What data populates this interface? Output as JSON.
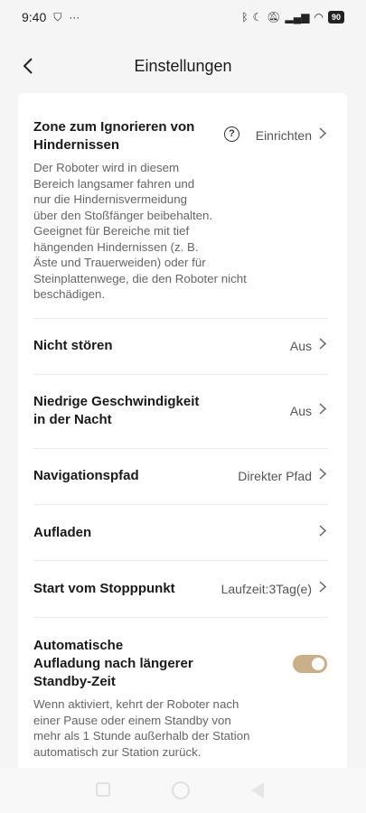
{
  "status_bar": {
    "time": "9:40",
    "battery": "90"
  },
  "header": {
    "title": "Einstellungen"
  },
  "settings": {
    "obstacle_zone": {
      "label_line1": "Zone zum Ignorieren von",
      "label_line2": "Hindernissen",
      "value": "Einrichten",
      "description": [
        "Der Roboter wird in diesem",
        "Bereich langsamer fahren und",
        "nur die Hindernisvermeidung",
        "über den Stoßfänger beibehalten.",
        "Geeignet für Bereiche mit tief",
        "hängenden Hindernissen (z. B.",
        "Äste und Trauerweiden) oder für",
        "Steinplattenwege, die den Roboter nicht",
        "beschädigen."
      ]
    },
    "do_not_disturb": {
      "label": "Nicht stören",
      "value": "Aus"
    },
    "night_speed": {
      "label_line1": "Niedrige Geschwindigkeit",
      "label_line2": "in der Nacht",
      "value": "Aus"
    },
    "nav_path": {
      "label": "Navigationspfad",
      "value": "Direkter Pfad"
    },
    "charging": {
      "label": "Aufladen"
    },
    "resume": {
      "label": "Start vom Stopppunkt",
      "value": "Laufzeit:3Tag(e)"
    },
    "auto_charge": {
      "label_line1": "Automatische",
      "label_line2": "Aufladung nach längerer",
      "label_line3": "Standby-Zeit",
      "enabled": true,
      "description": [
        "Wenn aktiviert, kehrt der Roboter nach",
        "einer Pause oder einem Standby von",
        "mehr als 1 Stunde außerhalb der Station",
        "automatisch zur Station zurück."
      ]
    }
  },
  "icons": {
    "back": "chevron-left-icon",
    "help": "question-circle-icon",
    "chevron": "chevron-right-icon"
  },
  "colors": {
    "toggle_on": "#c9b089",
    "background": "#f5f5f5",
    "card": "#ffffff"
  }
}
